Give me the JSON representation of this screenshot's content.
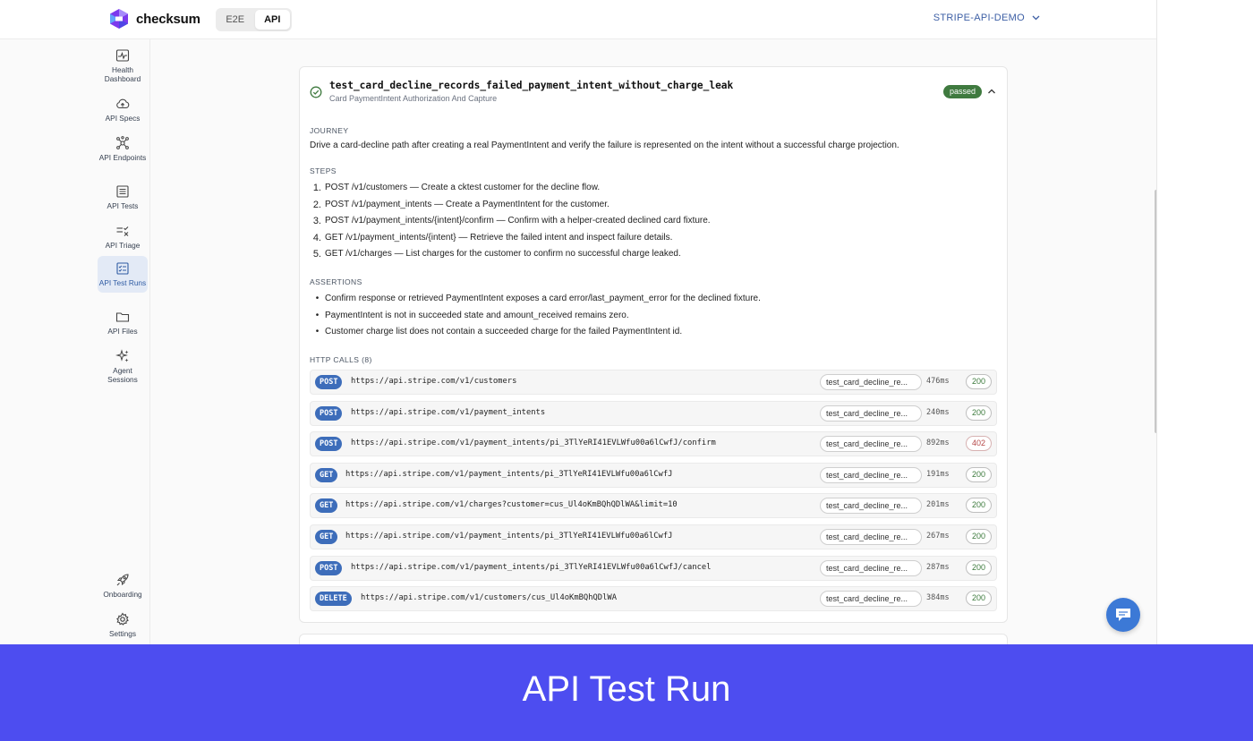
{
  "brand": {
    "name": "checksum"
  },
  "mode_toggle": {
    "options": [
      "E2E",
      "API"
    ],
    "active": "API"
  },
  "workspace": {
    "name": "STRIPE-API-DEMO"
  },
  "sidebar": {
    "items": [
      {
        "label": "Health Dashboard",
        "icon": "activity-icon"
      },
      {
        "label": "API Specs",
        "icon": "cloud-upload-icon"
      },
      {
        "label": "API Endpoints",
        "icon": "network-icon"
      },
      {
        "label": "API Tests",
        "icon": "list-box-icon"
      },
      {
        "label": "API Triage",
        "icon": "triage-icon"
      },
      {
        "label": "API Test Runs",
        "icon": "checklist-icon",
        "active": true
      },
      {
        "label": "API Files",
        "icon": "folder-icon"
      },
      {
        "label": "Agent Sessions",
        "icon": "sparkles-icon"
      }
    ],
    "bottom": [
      {
        "label": "Onboarding",
        "icon": "rocket-icon"
      },
      {
        "label": "Settings",
        "icon": "gear-icon"
      }
    ]
  },
  "test": {
    "name": "test_card_decline_records_failed_payment_intent_without_charge_leak",
    "subtitle": "Card PaymentIntent Authorization And Capture",
    "status": "passed",
    "journey_heading": "JOURNEY",
    "journey": "Drive a card-decline path after creating a real PaymentIntent and verify the failure is represented on the intent without a successful charge projection.",
    "steps_heading": "STEPS",
    "steps": [
      "POST /v1/customers — Create a cktest customer for the decline flow.",
      "POST /v1/payment_intents — Create a PaymentIntent for the customer.",
      "POST /v1/payment_intents/{intent}/confirm — Confirm with a helper-created declined card fixture.",
      "GET /v1/payment_intents/{intent} — Retrieve the failed intent and inspect failure details.",
      "GET /v1/charges — List charges for the customer to confirm no successful charge leaked."
    ],
    "assertions_heading": "ASSERTIONS",
    "assertions": [
      "Confirm response or retrieved PaymentIntent exposes a card error/last_payment_error for the declined fixture.",
      "PaymentIntent is not in succeeded state and amount_received remains zero.",
      "Customer charge list does not contain a succeeded charge for the failed PaymentIntent id."
    ],
    "http_calls_heading": "HTTP CALLS (8)",
    "http_calls": [
      {
        "method": "POST",
        "url": "https://api.stripe.com/v1/customers",
        "tag": "test_card_decline_re...",
        "ms": "476ms",
        "status": "200"
      },
      {
        "method": "POST",
        "url": "https://api.stripe.com/v1/payment_intents",
        "tag": "test_card_decline_re...",
        "ms": "240ms",
        "status": "200"
      },
      {
        "method": "POST",
        "url": "https://api.stripe.com/v1/payment_intents/pi_3TlYeRI41EVLWfu00a6lCwfJ/confirm",
        "tag": "test_card_decline_re...",
        "ms": "892ms",
        "status": "402"
      },
      {
        "method": "GET",
        "url": "https://api.stripe.com/v1/payment_intents/pi_3TlYeRI41EVLWfu00a6lCwfJ",
        "tag": "test_card_decline_re...",
        "ms": "191ms",
        "status": "200"
      },
      {
        "method": "GET",
        "url": "https://api.stripe.com/v1/charges?customer=cus_Ul4oKmBQhQDlWA&limit=10",
        "tag": "test_card_decline_re...",
        "ms": "201ms",
        "status": "200"
      },
      {
        "method": "GET",
        "url": "https://api.stripe.com/v1/payment_intents/pi_3TlYeRI41EVLWfu00a6lCwfJ",
        "tag": "test_card_decline_re...",
        "ms": "267ms",
        "status": "200"
      },
      {
        "method": "POST",
        "url": "https://api.stripe.com/v1/payment_intents/pi_3TlYeRI41EVLWfu00a6lCwfJ/cancel",
        "tag": "test_card_decline_re...",
        "ms": "287ms",
        "status": "200"
      },
      {
        "method": "DELETE",
        "url": "https://api.stripe.com/v1/customers/cus_Ul4oKmBQhQDlWA",
        "tag": "test_card_decline_re...",
        "ms": "384ms",
        "status": "200"
      }
    ]
  },
  "banner": {
    "title": "API Test Run"
  },
  "colors": {
    "accent": "#3d6dba",
    "passed": "#3f7a3f",
    "banner": "#4d4df0",
    "error": "#b54848"
  }
}
